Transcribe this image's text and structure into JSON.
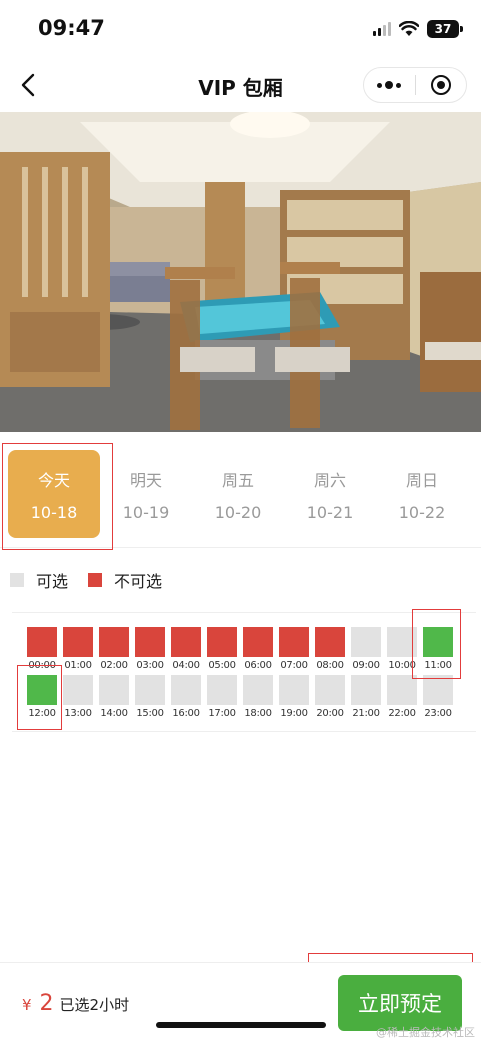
{
  "status_bar": {
    "time": "09:47",
    "battery": "37"
  },
  "nav": {
    "title": "VIP 包厢"
  },
  "dates": [
    {
      "day": "今天",
      "date": "10-18",
      "active": true
    },
    {
      "day": "明天",
      "date": "10-19",
      "active": false
    },
    {
      "day": "周五",
      "date": "10-20",
      "active": false
    },
    {
      "day": "周六",
      "date": "10-21",
      "active": false
    },
    {
      "day": "周日",
      "date": "10-22",
      "active": false
    }
  ],
  "legend": {
    "available": "可选",
    "unavailable": "不可选"
  },
  "slots": [
    {
      "time": "00:00",
      "state": "booked"
    },
    {
      "time": "01:00",
      "state": "booked"
    },
    {
      "time": "02:00",
      "state": "booked"
    },
    {
      "time": "03:00",
      "state": "booked"
    },
    {
      "time": "04:00",
      "state": "booked"
    },
    {
      "time": "05:00",
      "state": "booked"
    },
    {
      "time": "06:00",
      "state": "booked"
    },
    {
      "time": "07:00",
      "state": "booked"
    },
    {
      "time": "08:00",
      "state": "booked"
    },
    {
      "time": "09:00",
      "state": "available"
    },
    {
      "time": "10:00",
      "state": "available"
    },
    {
      "time": "11:00",
      "state": "selected"
    },
    {
      "time": "12:00",
      "state": "selected"
    },
    {
      "time": "13:00",
      "state": "available"
    },
    {
      "time": "14:00",
      "state": "available"
    },
    {
      "time": "15:00",
      "state": "available"
    },
    {
      "time": "16:00",
      "state": "available"
    },
    {
      "time": "17:00",
      "state": "available"
    },
    {
      "time": "18:00",
      "state": "available"
    },
    {
      "time": "19:00",
      "state": "available"
    },
    {
      "time": "20:00",
      "state": "available"
    },
    {
      "time": "21:00",
      "state": "available"
    },
    {
      "time": "22:00",
      "state": "available"
    },
    {
      "time": "23:00",
      "state": "available"
    }
  ],
  "footer": {
    "currency": "¥",
    "price": "2",
    "selected_text": "已选2小时",
    "book_label": "立即预定",
    "watermark": "@稀土掘金技术社区"
  },
  "colors": {
    "booked": "#d9453c",
    "available": "#e2e2e2",
    "selected": "#50b84a",
    "active_tab": "#e8ad4e",
    "book_button": "#4aae3f"
  }
}
